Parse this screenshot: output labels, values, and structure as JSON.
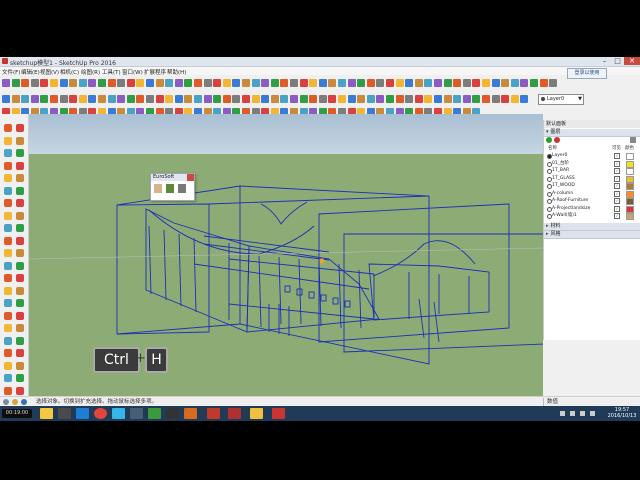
{
  "window": {
    "title": "sketchup模型1 - SketchUp Pro 2016",
    "minimize": "–",
    "maximize": "□",
    "close": "✕",
    "signin_label": "登录以使用"
  },
  "menubar": {
    "items": [
      "文件(F)",
      "编辑(E)",
      "视图(V)",
      "相机(C)",
      "绘图(R)",
      "工具(T)",
      "窗口(W)",
      "扩展程序",
      "帮助(H)"
    ]
  },
  "layer_selector": {
    "current": "Layer0",
    "arrow": "▼"
  },
  "plugin_panel": {
    "title": "EuroSoft"
  },
  "shortcut_overlay": {
    "key1": "Ctrl",
    "plus": "+",
    "key2": "H"
  },
  "default_tray": {
    "title": "默认面板",
    "layers_section": "图层",
    "column_name": "名称",
    "column_visible": "可见",
    "column_color": "颜色",
    "layers": [
      {
        "name": "Layer0",
        "active": true,
        "visible": true,
        "color": "#ffffff"
      },
      {
        "name": "01_台阶",
        "active": false,
        "visible": true,
        "color": "#f5e01a"
      },
      {
        "name": "1T_BAR",
        "active": false,
        "visible": true,
        "color": "#ffffff"
      },
      {
        "name": "1T_GLASS",
        "active": false,
        "visible": true,
        "color": "#e8c12c"
      },
      {
        "name": "1T_WOOD",
        "active": false,
        "visible": true,
        "color": "#b57a2e"
      },
      {
        "name": "A-column",
        "active": false,
        "visible": true,
        "color": "#ff8a1f"
      },
      {
        "name": "A-Roof-Furniture",
        "active": false,
        "visible": true,
        "color": "#7b5a3a"
      },
      {
        "name": "A-Projectlandsize",
        "active": false,
        "visible": true,
        "color": "#e23333"
      },
      {
        "name": "A-Wall(墙)1",
        "active": false,
        "visible": true,
        "color": "#c9a36a"
      }
    ],
    "section_materials": "材料",
    "section_styles": "风格"
  },
  "statusbar": {
    "message": "选择对象。切换到扩充选择。拖动鼠标选择多项。",
    "measure_label": "数值"
  },
  "taskbar": {
    "time": "19:57",
    "date": "2016/10/13",
    "recording_time": "00:19:00"
  }
}
